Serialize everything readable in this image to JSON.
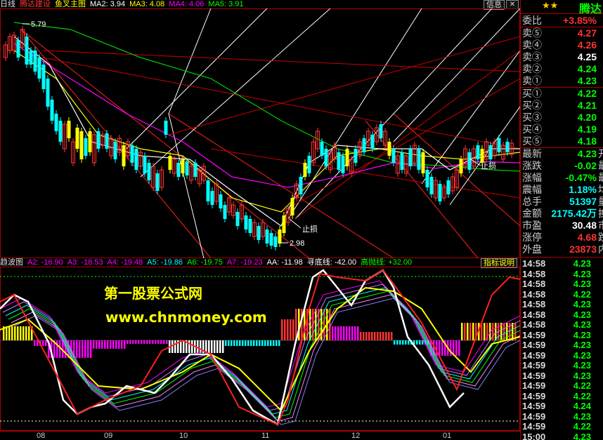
{
  "main_header": {
    "period": "日线",
    "stock_name": "腾达建设",
    "indicator": "鱼叉主图",
    "ma": [
      {
        "label": "MA2: 3.94",
        "color": "#ffffff"
      },
      {
        "label": "MA3: 4.08",
        "color": "#ffff00"
      },
      {
        "label": "MA4: 4.06",
        "color": "#ff00ff"
      },
      {
        "label": "MA5: 3.91",
        "color": "#00ff00"
      }
    ],
    "info_button": "信息"
  },
  "annotations": {
    "high_price": "5.79",
    "low_price": "2.98",
    "stop_loss_1": "止损",
    "stop_loss_2": "止损"
  },
  "osc_header": {
    "name": "趋波图",
    "values": [
      {
        "label": "A2: -16.90",
        "color": "#ff00ff"
      },
      {
        "label": "A3: -18.53",
        "color": "#ff00ff"
      },
      {
        "label": "A4: -19.48",
        "color": "#ff00ff"
      },
      {
        "label": "A5: -19.86",
        "color": "#00ffff"
      },
      {
        "label": "A6: -19.75",
        "color": "#00ff00"
      },
      {
        "label": "A7: -19.23",
        "color": "#ff00ff"
      },
      {
        "label": "AA: -11.98",
        "color": "#ffffff"
      },
      {
        "label": "寻底线: -42.00",
        "color": "#ffffff"
      },
      {
        "label": "高抛线: +32.00",
        "color": "#00ff00"
      }
    ],
    "help_button": "指标说明"
  },
  "watermark": {
    "site_name": "第一股票公式网",
    "url": "www.chnmoney.com"
  },
  "xaxis": {
    "labels": [
      "08",
      "09",
      "10",
      "11",
      "12",
      "01"
    ]
  },
  "panel": {
    "stars": "★★",
    "name": "腾达",
    "wei_bi": {
      "label": "委比",
      "value": "+3.85%"
    },
    "asks": [
      {
        "label": "卖⑤",
        "price": "4.27",
        "color": "#ff3333"
      },
      {
        "label": "卖④",
        "price": "4.26",
        "color": "#ff3333"
      },
      {
        "label": "卖③",
        "price": "4.25",
        "color": "#ffffff"
      },
      {
        "label": "卖②",
        "price": "4.24",
        "color": "#00ff00"
      },
      {
        "label": "卖①",
        "price": "4.23",
        "color": "#00ff00"
      }
    ],
    "bids": [
      {
        "label": "买①",
        "price": "4.22",
        "color": "#00ff00"
      },
      {
        "label": "买②",
        "price": "4.21",
        "color": "#00ff00"
      },
      {
        "label": "买③",
        "price": "4.20",
        "color": "#00ff00"
      },
      {
        "label": "买④",
        "price": "4.19",
        "color": "#00ff00"
      },
      {
        "label": "买⑤",
        "price": "4.18",
        "color": "#00ff00"
      }
    ],
    "stats": [
      {
        "label": "最新",
        "value": "4.23",
        "color": "#00ff00",
        "cut": "开"
      },
      {
        "label": "涨跌",
        "value": "-0.02",
        "color": "#00ff00",
        "cut": "最"
      },
      {
        "label": "涨幅",
        "value": "-0.47%",
        "color": "#00ff00",
        "cut": "最"
      },
      {
        "label": "震幅",
        "value": "1.18%",
        "color": "#00ffff",
        "cut": "均"
      },
      {
        "label": "总手",
        "value": "51397",
        "color": "#00ffff",
        "cut": "量"
      },
      {
        "label": "金额",
        "value": "2175.42万",
        "color": "#00ffff",
        "cut": "换"
      },
      {
        "label": "市盈",
        "value": "30.48",
        "color": "#ffffff",
        "cut": "市"
      },
      {
        "label": "涨停",
        "value": "4.68",
        "color": "#ff3333",
        "cut": "跌"
      },
      {
        "label": "外盘",
        "value": "23873",
        "color": "#ff3333",
        "cut": "内"
      }
    ],
    "ticks": [
      {
        "time": "14:58",
        "price": "4.23"
      },
      {
        "time": "14:58",
        "price": "4.23"
      },
      {
        "time": "14:58",
        "price": "4.23"
      },
      {
        "time": "14:58",
        "price": "4.22"
      },
      {
        "time": "14:58",
        "price": "4.23"
      },
      {
        "time": "14:58",
        "price": "4.23"
      },
      {
        "time": "14:58",
        "price": "4.23"
      },
      {
        "time": "14:59",
        "price": "4.23"
      },
      {
        "time": "14:59",
        "price": "4.23"
      },
      {
        "time": "14:59",
        "price": "4.23"
      },
      {
        "time": "14:59",
        "price": "4.23"
      },
      {
        "time": "14:59",
        "price": "4.23"
      },
      {
        "time": "14:59",
        "price": "4.22"
      },
      {
        "time": "14:59",
        "price": "4.22"
      },
      {
        "time": "14:59",
        "price": "4.24"
      },
      {
        "time": "14:59",
        "price": "4.23"
      },
      {
        "time": "14:59",
        "price": "4.22"
      },
      {
        "time": "15:00",
        "price": "4.23"
      }
    ]
  },
  "colors": {
    "up": "#ff3333",
    "down": "#00ffff",
    "yellow_candle": "#ffff00",
    "frame": "#aa0000"
  }
}
